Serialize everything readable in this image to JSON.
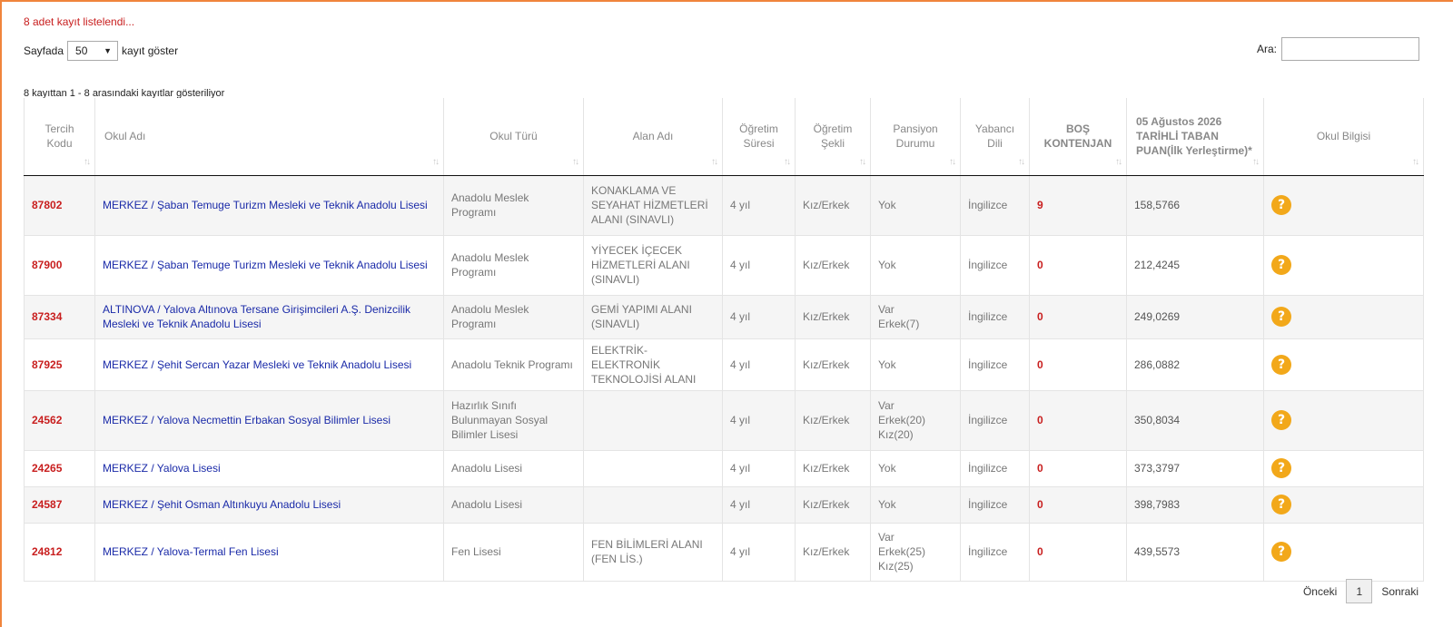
{
  "status_message": "8 adet kayıt listelendi...",
  "length_menu": {
    "prefix": "Sayfada",
    "selected": "50",
    "suffix": "kayıt göster"
  },
  "search": {
    "label": "Ara:",
    "value": ""
  },
  "info": "8 kayıttan 1 - 8 arasındaki kayıtlar gösteriliyor",
  "columns": [
    "Tercih Kodu",
    "Okul Adı",
    "Okul Türü",
    "Alan Adı",
    "Öğretim Süresi",
    "Öğretim Şekli",
    "Pansiyon Durumu",
    "Yabancı Dili",
    "BOŞ KONTENJAN",
    "05 Ağustos 2026 TARİHLİ TABAN PUAN(İlk Yerleştirme)*",
    "Okul Bilgisi"
  ],
  "rows": [
    {
      "code": "87802",
      "okul": "MERKEZ / Şaban Temuge Turizm Mesleki ve Teknik Anadolu Lisesi",
      "tur": "Anadolu Meslek Programı",
      "alan": "KONAKLAMA VE SEYAHAT HİZMETLERİ ALANI (SINAVLI)",
      "sure": "4 yıl",
      "sekil": "Kız/Erkek",
      "pansiyon": "Yok",
      "dil": "İngilizce",
      "bos": "9",
      "puan": "158,5766"
    },
    {
      "code": "87900",
      "okul": "MERKEZ / Şaban Temuge Turizm Mesleki ve Teknik Anadolu Lisesi",
      "tur": "Anadolu Meslek Programı",
      "alan": "YİYECEK İÇECEK HİZMETLERİ ALANI (SINAVLI)",
      "sure": "4 yıl",
      "sekil": "Kız/Erkek",
      "pansiyon": "Yok",
      "dil": "İngilizce",
      "bos": "0",
      "puan": "212,4245"
    },
    {
      "code": "87334",
      "okul": "ALTINOVA / Yalova Altınova Tersane Girişimcileri A.Ş. Denizcilik Mesleki ve Teknik Anadolu Lisesi",
      "tur": "Anadolu Meslek Programı",
      "alan": "GEMİ YAPIMI ALANI (SINAVLI)",
      "sure": "4 yıl",
      "sekil": "Kız/Erkek",
      "pansiyon": "Var\nErkek(7)",
      "dil": "İngilizce",
      "bos": "0",
      "puan": "249,0269"
    },
    {
      "code": "87925",
      "okul": "MERKEZ / Şehit Sercan Yazar Mesleki ve Teknik Anadolu Lisesi",
      "tur": "Anadolu Teknik Programı",
      "alan": "ELEKTRİK-ELEKTRONİK TEKNOLOJİSİ ALANI",
      "sure": "4 yıl",
      "sekil": "Kız/Erkek",
      "pansiyon": "Yok",
      "dil": "İngilizce",
      "bos": "0",
      "puan": "286,0882"
    },
    {
      "code": "24562",
      "okul": "MERKEZ / Yalova Necmettin Erbakan Sosyal Bilimler Lisesi",
      "tur": "Hazırlık Sınıfı Bulunmayan Sosyal Bilimler Lisesi",
      "alan": "",
      "sure": "4 yıl",
      "sekil": "Kız/Erkek",
      "pansiyon": "Var\nErkek(20)\nKız(20)",
      "dil": "İngilizce",
      "bos": "0",
      "puan": "350,8034"
    },
    {
      "code": "24265",
      "okul": "MERKEZ / Yalova Lisesi",
      "tur": "Anadolu Lisesi",
      "alan": "",
      "sure": "4 yıl",
      "sekil": "Kız/Erkek",
      "pansiyon": "Yok",
      "dil": "İngilizce",
      "bos": "0",
      "puan": "373,3797"
    },
    {
      "code": "24587",
      "okul": "MERKEZ / Şehit Osman Altınkuyu Anadolu Lisesi",
      "tur": "Anadolu Lisesi",
      "alan": "",
      "sure": "4 yıl",
      "sekil": "Kız/Erkek",
      "pansiyon": "Yok",
      "dil": "İngilizce",
      "bos": "0",
      "puan": "398,7983"
    },
    {
      "code": "24812",
      "okul": "MERKEZ / Yalova-Termal Fen Lisesi",
      "tur": "Fen Lisesi",
      "alan": "FEN BİLİMLERİ ALANI (FEN LİS.)",
      "sure": "4 yıl",
      "sekil": "Kız/Erkek",
      "pansiyon": "Var\nErkek(25)\nKız(25)",
      "dil": "İngilizce",
      "bos": "0",
      "puan": "439,5573"
    }
  ],
  "row_icon": "question-circle-icon",
  "row_icon_glyph": "?",
  "pager": {
    "prev": "Önceki",
    "current": "1",
    "next": "Sonraki"
  },
  "colors": {
    "accent_border": "#f0843c",
    "code_red": "#c81e1e",
    "link_blue": "#1a2aa8",
    "info_icon": "#f2a81a"
  }
}
